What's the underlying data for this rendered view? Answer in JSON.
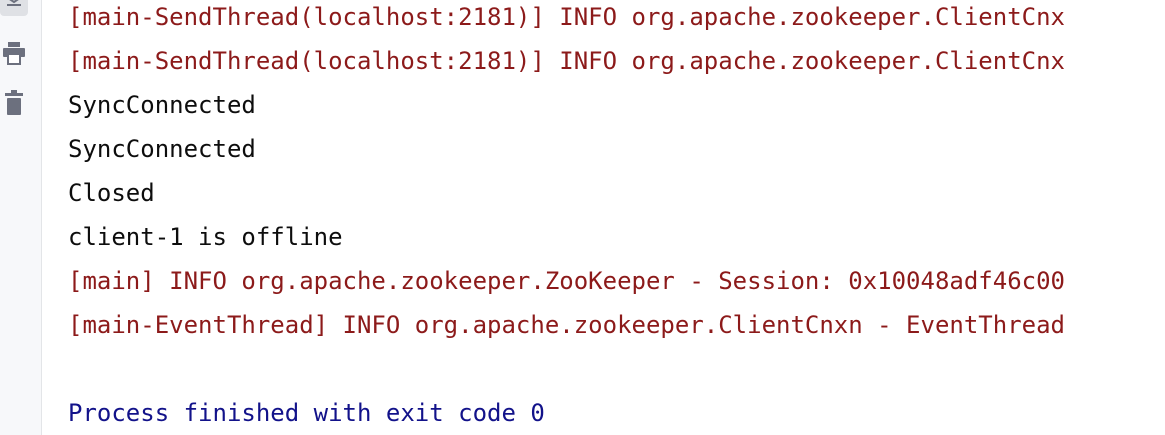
{
  "toolbar": {
    "scroll_icon": "scroll-to-end-icon",
    "print_icon": "print-icon",
    "clear_icon": "trash-icon"
  },
  "colors": {
    "stderr": "#8c1a1a",
    "stdout": "#0d0d0d",
    "system": "#12128a",
    "gutter_bg": "#f7f8fa"
  },
  "console": {
    "lines": [
      {
        "kind": "err",
        "text": "[main-SendThread(localhost:2181)] INFO org.apache.zookeeper.ClientCnx"
      },
      {
        "kind": "err",
        "text": "[main-SendThread(localhost:2181)] INFO org.apache.zookeeper.ClientCnx"
      },
      {
        "kind": "out",
        "text": "SyncConnected"
      },
      {
        "kind": "out",
        "text": "SyncConnected"
      },
      {
        "kind": "out",
        "text": "Closed"
      },
      {
        "kind": "out",
        "text": "client-1 is offline"
      },
      {
        "kind": "err",
        "text": "[main] INFO org.apache.zookeeper.ZooKeeper - Session: 0x10048adf46c00"
      },
      {
        "kind": "err",
        "text": "[main-EventThread] INFO org.apache.zookeeper.ClientCnxn - EventThread"
      },
      {
        "kind": "blank",
        "text": ""
      },
      {
        "kind": "sys",
        "text": "Process finished with exit code 0"
      }
    ]
  }
}
